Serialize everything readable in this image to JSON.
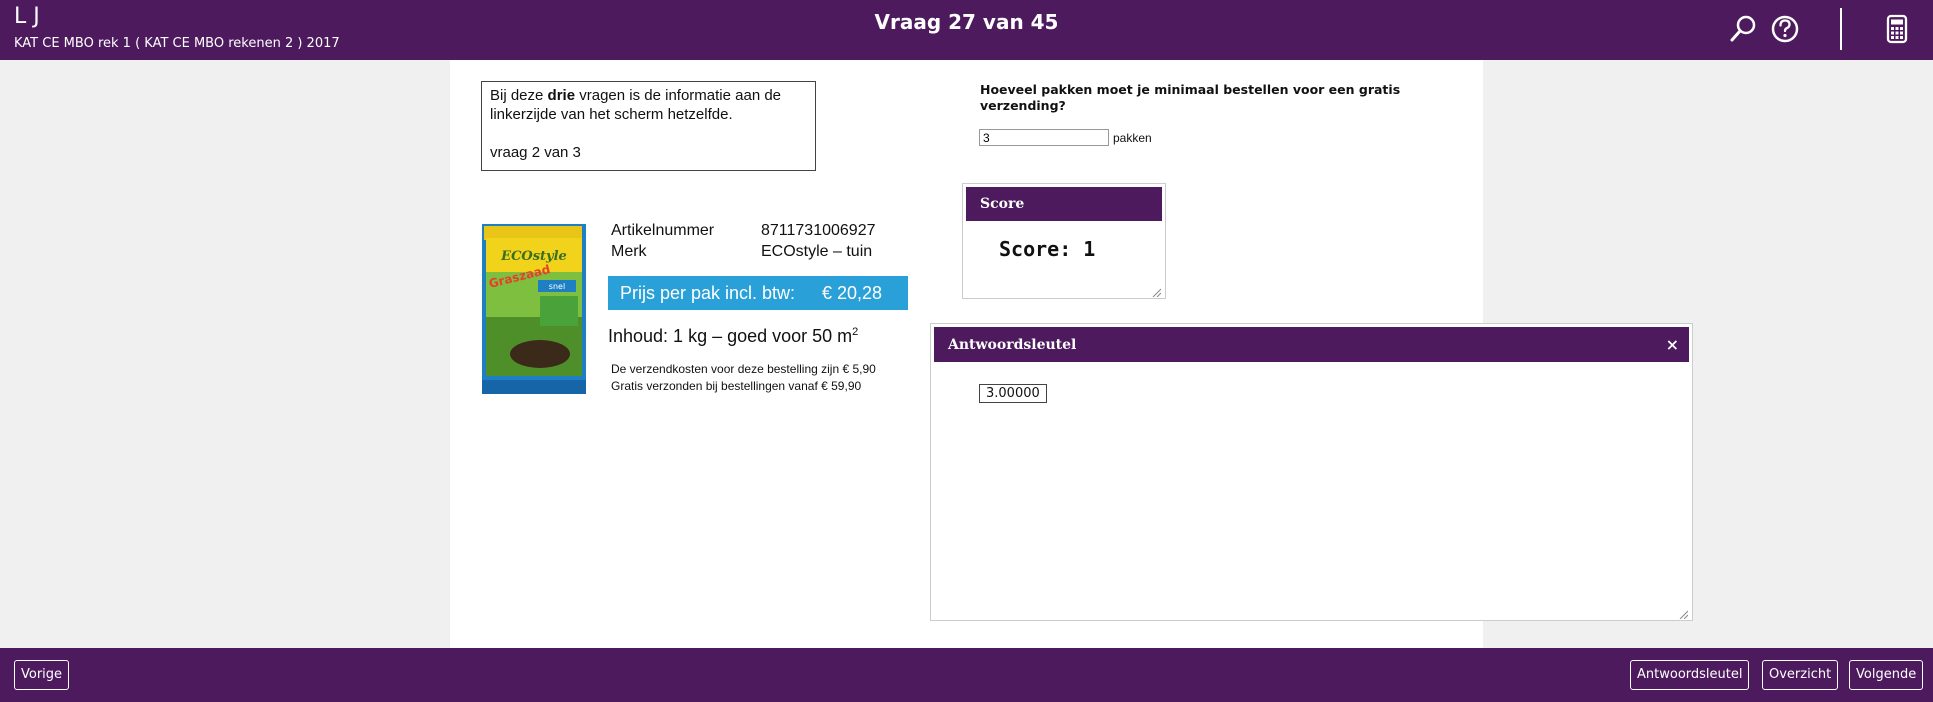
{
  "header": {
    "user_initials": "L J",
    "test_name": "KAT CE MBO rek 1 ( KAT CE MBO rekenen 2 ) 2017",
    "question_counter": "Vraag 27 van 45"
  },
  "info_box": {
    "line1_before": "Bij deze ",
    "line1_bold": "drie",
    "line1_after": " vragen is de informatie aan de",
    "line2": "linkerzijde van het scherm hetzelfde.",
    "line3": "vraag 2 van 3"
  },
  "product": {
    "label_article": "Artikelnummer",
    "value_article": "8711731006927",
    "label_brand": "Merk",
    "value_brand": "ECOstyle – tuin",
    "price_label": "Prijs per pak incl. btw:",
    "price_value": "€ 20,28",
    "content_text": "Inhoud: 1 kg – goed voor 50 m",
    "content_sup": "2",
    "shipping_note": "De verzendkosten voor deze bestelling zijn € 5,90",
    "free_shipping_note": "Gratis verzonden bij bestellingen vanaf € 59,90",
    "box_brand": "ECOstyle",
    "box_product": "Graszaad",
    "box_tag": "snel"
  },
  "question": {
    "text": "Hoeveel pakken moet je minimaal bestellen voor een gratis verzending?",
    "answer_value": "3",
    "unit": "pakken"
  },
  "score_panel": {
    "title": "Score",
    "score_text": "Score: 1"
  },
  "key_panel": {
    "title": "Antwoordsleutel",
    "close": "×",
    "value": "3.00000"
  },
  "footer": {
    "prev": "Vorige",
    "answer_key": "Antwoordsleutel",
    "overview": "Overzicht",
    "next": "Volgende"
  },
  "colors": {
    "brand_purple": "#4d1a5e",
    "price_blue": "#2aa0d8"
  }
}
